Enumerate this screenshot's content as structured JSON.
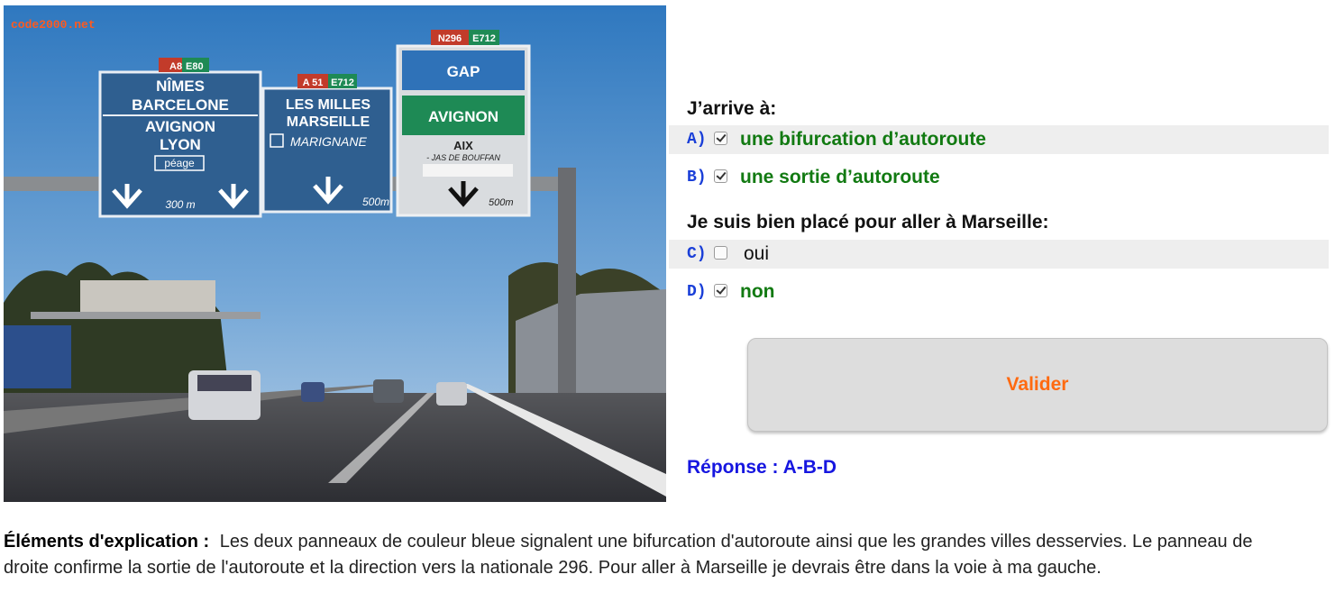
{
  "photo": {
    "watermark": "code2000.net",
    "signs": {
      "left": {
        "route_a": "A8",
        "route_e": "E80",
        "lines": [
          "NÎMES",
          "BARCELONE",
          "AVIGNON",
          "LYON"
        ],
        "toll": "péage",
        "distance": "300 m"
      },
      "middle": {
        "route_a": "A 51",
        "route_e": "E712",
        "lines": [
          "LES MILLES",
          "MARSEILLE"
        ],
        "airport": "MARIGNANE",
        "distance": "500m"
      },
      "right": {
        "route_n": "N296",
        "route_e": "E712",
        "top": "GAP",
        "middle": "AVIGNON",
        "city": "AIX",
        "sub": "- JAS DE BOUFFAN",
        "distance": "500m"
      }
    }
  },
  "questions": [
    {
      "title": "J’arrive à:",
      "options": [
        {
          "letter": "A)",
          "text": "une bifurcation d’autoroute",
          "checked": true,
          "correct": true
        },
        {
          "letter": "B)",
          "text": "une sortie d’autoroute",
          "checked": true,
          "correct": true
        }
      ]
    },
    {
      "title": "Je suis bien placé pour aller à Marseille:",
      "options": [
        {
          "letter": "C)",
          "text": "oui",
          "checked": false,
          "correct": false
        },
        {
          "letter": "D)",
          "text": "non",
          "checked": true,
          "correct": true
        }
      ]
    }
  ],
  "validate_label": "Valider",
  "answer": "Réponse : A-B-D",
  "explanation": {
    "label": "Éléments d'explication :",
    "text": "Les deux panneaux de couleur bleue signalent une bifurcation d'autoroute ainsi que les grandes villes desservies. Le panneau de droite confirme la sortie de l'autoroute et la direction vers la nationale 296. Pour aller à Marseille je devrais être dans la voie à ma gauche."
  },
  "colors": {
    "correct": "#127a12",
    "letter": "#1a3fd8",
    "validate": "#ff6a10",
    "answer": "#1616e0",
    "sign_blue": "#2f5f90",
    "sign_green": "#1e8a55"
  }
}
